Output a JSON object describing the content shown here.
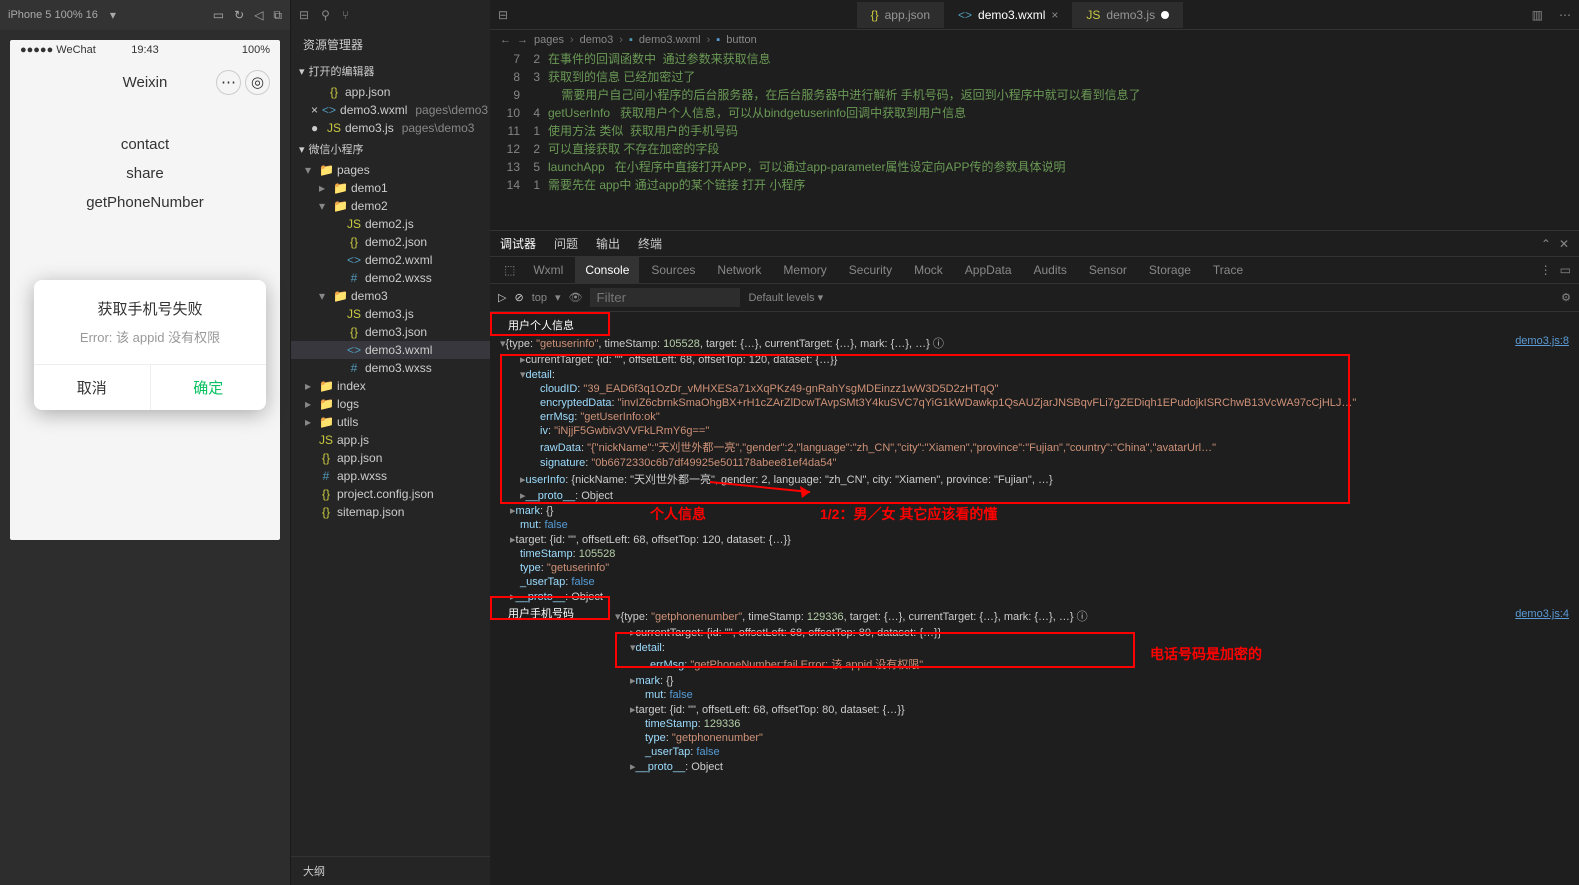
{
  "simulator": {
    "device": "iPhone 5 100% 16",
    "statusbar": {
      "carrier": "●●●●● WeChat",
      "time": "19:43",
      "battery": "100%"
    },
    "nav_title": "Weixin",
    "buttons": [
      "contact",
      "share",
      "getPhoneNumber"
    ],
    "modal": {
      "title": "获取手机号失败",
      "message": "Error: 该 appid 没有权限",
      "cancel": "取消",
      "ok": "确定"
    }
  },
  "explorer": {
    "title": "资源管理器",
    "sections": {
      "open_editors": "打开的编辑器",
      "project": "微信小程序",
      "outline": "大纲"
    },
    "open_editors": [
      {
        "icon": "{}",
        "cls": "ico-json",
        "name": "app.json"
      },
      {
        "icon": "<>",
        "cls": "ico-wxml",
        "name": "demo3.wxml",
        "path": "pages\\demo3",
        "close": true
      },
      {
        "icon": "JS",
        "cls": "ico-js",
        "name": "demo3.js",
        "path": "pages\\demo3",
        "dot": true
      }
    ],
    "tree": [
      {
        "indent": 0,
        "chev": "▾",
        "icon": "📁",
        "cls": "ico-folder",
        "name": "pages"
      },
      {
        "indent": 1,
        "chev": "▸",
        "icon": "📁",
        "cls": "ico-folder",
        "name": "demo1"
      },
      {
        "indent": 1,
        "chev": "▾",
        "icon": "📁",
        "cls": "ico-folder",
        "name": "demo2"
      },
      {
        "indent": 2,
        "icon": "JS",
        "cls": "ico-js",
        "name": "demo2.js"
      },
      {
        "indent": 2,
        "icon": "{}",
        "cls": "ico-json",
        "name": "demo2.json"
      },
      {
        "indent": 2,
        "icon": "<>",
        "cls": "ico-wxml",
        "name": "demo2.wxml"
      },
      {
        "indent": 2,
        "icon": "#",
        "cls": "ico-wxss",
        "name": "demo2.wxss"
      },
      {
        "indent": 1,
        "chev": "▾",
        "icon": "📁",
        "cls": "ico-folder",
        "name": "demo3"
      },
      {
        "indent": 2,
        "icon": "JS",
        "cls": "ico-js",
        "name": "demo3.js"
      },
      {
        "indent": 2,
        "icon": "{}",
        "cls": "ico-json",
        "name": "demo3.json"
      },
      {
        "indent": 2,
        "icon": "<>",
        "cls": "ico-wxml",
        "name": "demo3.wxml",
        "sel": true
      },
      {
        "indent": 2,
        "icon": "#",
        "cls": "ico-wxss",
        "name": "demo3.wxss"
      },
      {
        "indent": 0,
        "chev": "▸",
        "icon": "📁",
        "cls": "ico-folder",
        "name": "index"
      },
      {
        "indent": 0,
        "chev": "▸",
        "icon": "📁",
        "cls": "ico-folder",
        "name": "logs"
      },
      {
        "indent": 0,
        "chev": "▸",
        "icon": "📁",
        "cls": "ico-folder",
        "name": "utils",
        "green": true
      },
      {
        "indent": 0,
        "icon": "JS",
        "cls": "ico-js",
        "name": "app.js"
      },
      {
        "indent": 0,
        "icon": "{}",
        "cls": "ico-json",
        "name": "app.json"
      },
      {
        "indent": 0,
        "icon": "#",
        "cls": "ico-wxss",
        "name": "app.wxss"
      },
      {
        "indent": 0,
        "icon": "{}",
        "cls": "ico-json",
        "name": "project.config.json"
      },
      {
        "indent": 0,
        "icon": "{}",
        "cls": "ico-json",
        "name": "sitemap.json"
      }
    ]
  },
  "editor": {
    "tabs": [
      {
        "icon": "{}",
        "cls": "ico-json",
        "name": "app.json"
      },
      {
        "icon": "<>",
        "cls": "ico-wxml",
        "name": "demo3.wxml",
        "active": true,
        "close": true
      },
      {
        "icon": "JS",
        "cls": "ico-js",
        "name": "demo3.js",
        "dot": true
      }
    ],
    "breadcrumb": [
      "pages",
      "demo3",
      "demo3.wxml",
      "button"
    ],
    "code": [
      {
        "l": 7,
        "n": "2",
        "t": "在事件的回调函数中  通过参数来获取信息"
      },
      {
        "l": 8,
        "n": "3",
        "t": "获取到的信息 已经加密过了"
      },
      {
        "l": 9,
        "n": "",
        "t": "    需要用户自己间小程序的后台服务器，在后台服务器中进行解析 手机号码，返回到小程序中就可以看到信息了"
      },
      {
        "l": 10,
        "n": "4",
        "t": "getUserInfo   获取用户个人信息，可以从bindgetuserinfo回调中获取到用户信息"
      },
      {
        "l": 11,
        "n": "1",
        "t": "使用方法 类似  获取用户的手机号码"
      },
      {
        "l": 12,
        "n": "2",
        "t": "可以直接获取 不存在加密的字段"
      },
      {
        "l": 13,
        "n": "5",
        "t": "launchApp   在小程序中直接打开APP，可以通过app-parameter属性设定向APP传的参数具体说明"
      },
      {
        "l": 14,
        "n": "1",
        "t": "需要先在 app中 通过app的某个链接 打开 小程序"
      }
    ]
  },
  "debugger": {
    "header_tabs": [
      "调试器",
      "问题",
      "输出",
      "终端"
    ],
    "devtools_tabs": [
      "Wxml",
      "Console",
      "Sources",
      "Network",
      "Memory",
      "Security",
      "Mock",
      "AppData",
      "Audits",
      "Sensor",
      "Storage",
      "Trace"
    ],
    "active_dt": "Console",
    "context": "top",
    "filter_placeholder": "Filter",
    "levels": "Default levels ▾",
    "annotations": {
      "userinfo_label": "用户个人信息",
      "phone_label": "用户手机号码",
      "personal_info": "个人信息",
      "gender_hint": "1/2：男／女  其它应该看的懂",
      "phone_encrypted": "电话号码是加密的"
    },
    "src1": "demo3.js:8",
    "src2": "demo3.js:4",
    "log1": {
      "type": "getuserinfo",
      "timeStamp": 105528,
      "detail": {
        "cloudID": "39_EAD6f3q1OzDr_vMHXESa71xXqPKz49-gnRahYsgMDEinzz1wW3D5D2zHTqQ",
        "encryptedData": "invIZ6cbrnkSmaOhgBX+rH1cZArZlDcwTAvpSMt3Y4kuSVC7qYiG1kWDawkp1QsAUZjarJNSBqvFLi7gZEDiqh1EPudojkISRChwB13VcWA97cCjHLJ…",
        "errMsg": "getUserInfo:ok",
        "iv": "iNjjF5Gwbiv3VVFkLRmY6g==",
        "rawData": "{\"nickName\":\"天刈世外都一亮\",\"gender\":2,\"language\":\"zh_CN\",\"city\":\"Xiamen\",\"province\":\"Fujian\",\"country\":\"China\",\"avatarUrl…",
        "signature": "0b6672330c6b7df49925e501178abee81ef4da54"
      },
      "userInfo": "{nickName: \"天刈世外都一亮\", gender: 2, language: \"zh_CN\", city: \"Xiamen\", province: \"Fujian\", …}",
      "currentTarget": "currentTarget: {id: \"\", offsetLeft: 68, offsetTop: 120, dataset: {…}}",
      "target": "target: {id: \"\", offsetLeft: 68, offsetTop: 120, dataset: {…}}"
    },
    "log2": {
      "type": "getphonenumber",
      "timeStamp": 129336,
      "currentTarget": "currentTarget: {id: \"\", offsetLeft: 68, offsetTop: 80, dataset: {…}}",
      "errMsg": "getPhoneNumber:fail Error: 该 appid 没有权限",
      "target": "target: {id: \"\", offsetLeft: 68, offsetTop: 80, dataset: {…}}"
    }
  }
}
